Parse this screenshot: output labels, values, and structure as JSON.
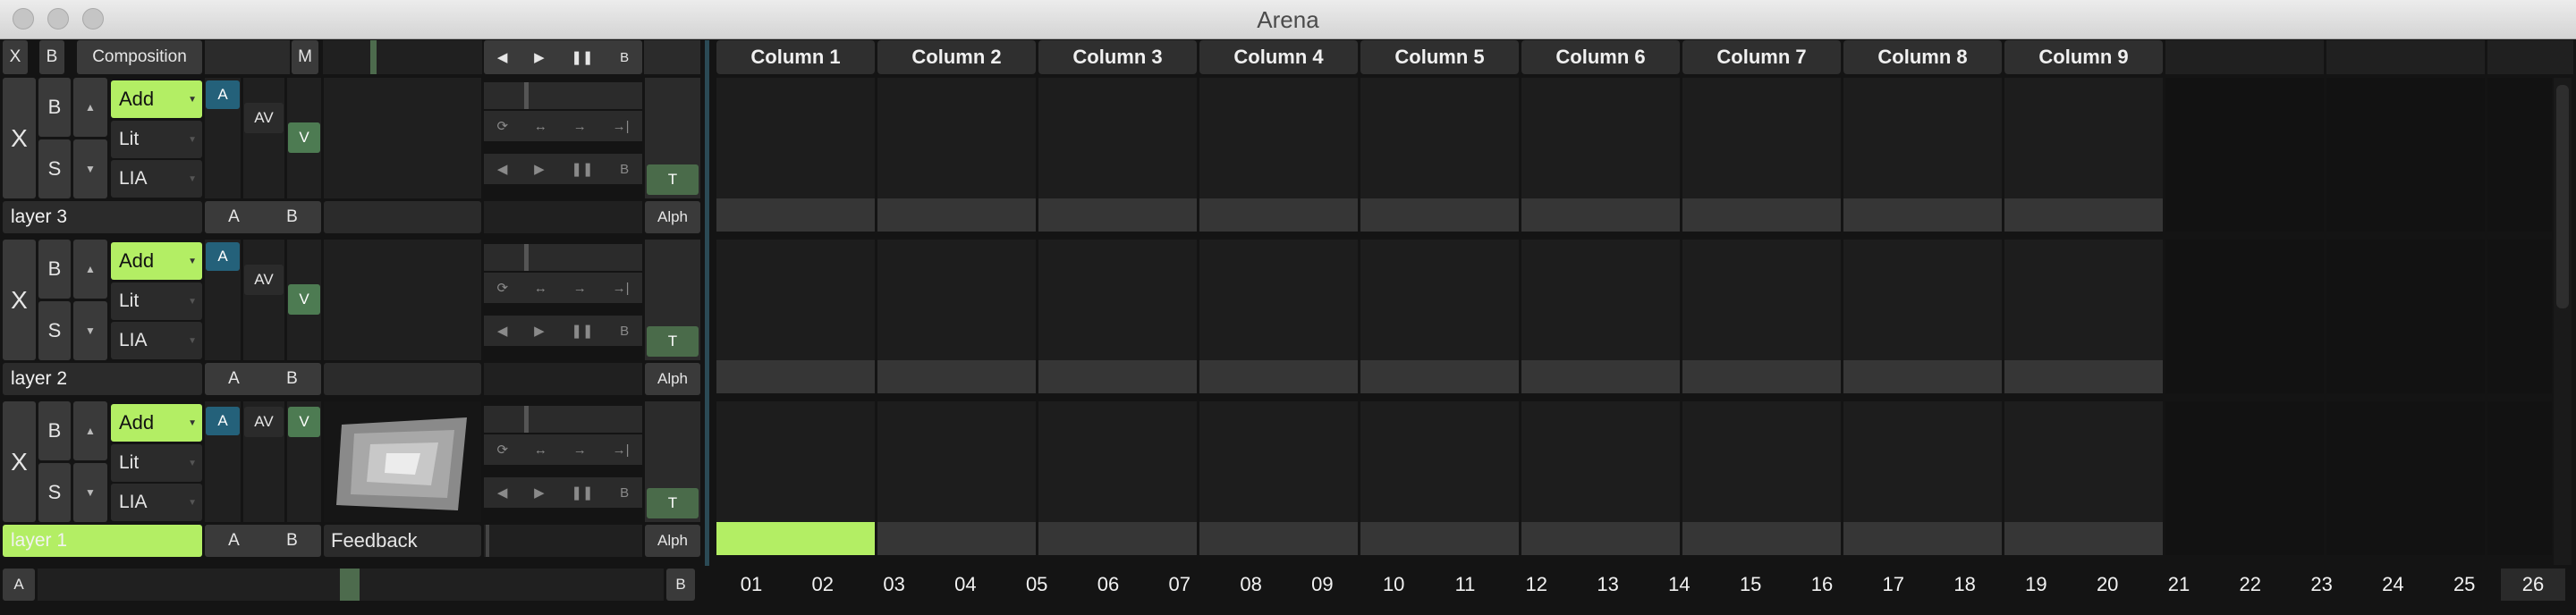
{
  "window": {
    "title": "Arena"
  },
  "header": {
    "x_label": "X",
    "b_label": "B",
    "composition_label": "Composition",
    "m_label": "M",
    "transport": [
      "◀",
      "▶",
      "❚❚",
      "B"
    ]
  },
  "columns": [
    "Column 1",
    "Column 2",
    "Column 3",
    "Column 4",
    "Column 5",
    "Column 6",
    "Column 7",
    "Column 8",
    "Column 9"
  ],
  "layers": [
    {
      "name": "layer 3",
      "x": "X",
      "b": "B",
      "s": "S",
      "blend_mode": "Add",
      "lit": "Lit",
      "lia": "LIA",
      "a": "A",
      "av": "AV",
      "v": "V",
      "t": "T",
      "alph": "Alph",
      "ab_a": "A",
      "ab_b": "B",
      "clip_name": "",
      "selected": false
    },
    {
      "name": "layer 2",
      "x": "X",
      "b": "B",
      "s": "S",
      "blend_mode": "Add",
      "lit": "Lit",
      "lia": "LIA",
      "a": "A",
      "av": "AV",
      "v": "V",
      "t": "T",
      "alph": "Alph",
      "ab_a": "A",
      "ab_b": "B",
      "clip_name": "",
      "selected": false
    },
    {
      "name": "layer 1",
      "x": "X",
      "b": "B",
      "s": "S",
      "blend_mode": "Add",
      "lit": "Lit",
      "lia": "LIA",
      "a": "A",
      "av": "AV",
      "v": "V",
      "t": "T",
      "alph": "Alph",
      "ab_a": "A",
      "ab_b": "B",
      "clip_name": "Feedback",
      "selected": true
    }
  ],
  "footer": {
    "a_label": "A",
    "b_label": "B",
    "deck_numbers": [
      "01",
      "02",
      "03",
      "04",
      "05",
      "06",
      "07",
      "08",
      "09",
      "10",
      "11",
      "12",
      "13",
      "14",
      "15",
      "16",
      "17",
      "18",
      "19",
      "20",
      "21",
      "22",
      "23",
      "24",
      "25",
      "26"
    ]
  },
  "colors": {
    "accent_green": "#b3ee64",
    "teal": "#24617a",
    "v_green": "#4d7b52"
  }
}
